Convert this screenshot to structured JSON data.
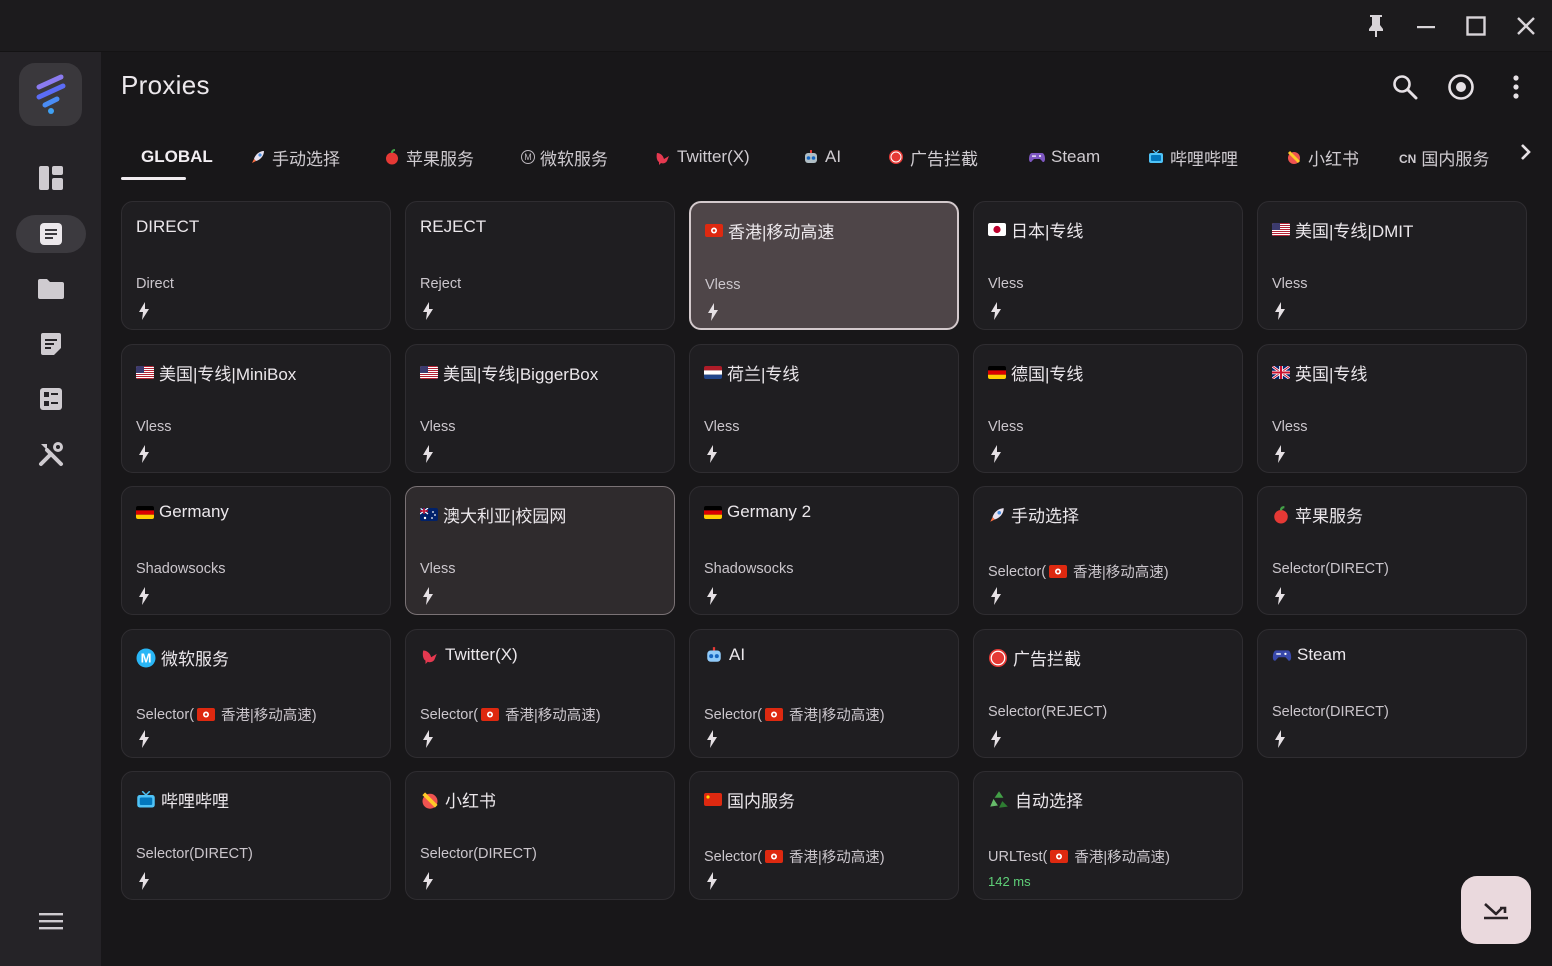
{
  "window_controls": {
    "pin": "pin-icon",
    "minimize": "minimize-icon",
    "maximize": "maximize-icon",
    "close": "close-icon"
  },
  "page": {
    "title": "Proxies"
  },
  "tabs": [
    {
      "label": "GLOBAL",
      "icon": ""
    },
    {
      "label": "手动选择",
      "icon": "rocket-icon"
    },
    {
      "label": "苹果服务",
      "icon": "apple-icon"
    },
    {
      "label": "微软服务",
      "icon": "microsoft-icon"
    },
    {
      "label": "Twitter(X)",
      "icon": "bird-icon"
    },
    {
      "label": "AI",
      "icon": "robot-icon"
    },
    {
      "label": "广告拦截",
      "icon": "stop-icon"
    },
    {
      "label": "Steam",
      "icon": "gamepad-icon"
    },
    {
      "label": "哔哩哔哩",
      "icon": "tv-icon"
    },
    {
      "label": "小红书",
      "icon": "red-icon"
    },
    {
      "label": "国内服务",
      "icon": "cn-icon",
      "prefix": "CN"
    }
  ],
  "proxies": [
    {
      "name": "DIRECT",
      "type": "Direct"
    },
    {
      "name": "REJECT",
      "type": "Reject"
    },
    {
      "name": "香港|移动高速",
      "type": "Vless",
      "flag": "hk",
      "selected": true
    },
    {
      "name": "日本|专线",
      "type": "Vless",
      "flag": "jp"
    },
    {
      "name": "美国|专线|DMIT",
      "type": "Vless",
      "flag": "us"
    },
    {
      "name": "美国|专线|MiniBox",
      "type": "Vless",
      "flag": "us"
    },
    {
      "name": "美国|专线|BiggerBox",
      "type": "Vless",
      "flag": "us"
    },
    {
      "name": "荷兰|专线",
      "type": "Vless",
      "flag": "nl"
    },
    {
      "name": "德国|专线",
      "type": "Vless",
      "flag": "de"
    },
    {
      "name": "英国|专线",
      "type": "Vless",
      "flag": "gb"
    },
    {
      "name": "Germany",
      "type": "Shadowsocks",
      "flag": "de"
    },
    {
      "name": "澳大利亚|校园网",
      "type": "Vless",
      "flag": "au",
      "highlight": true
    },
    {
      "name": "Germany 2",
      "type": "Shadowsocks",
      "flag": "de"
    },
    {
      "name": "手动选择",
      "type": "Selector(",
      "type_flag": "hk",
      "type_rest": "香港|移动高速)",
      "icon": "rocket-icon"
    },
    {
      "name": "苹果服务",
      "type": "Selector(DIRECT)",
      "icon": "apple-icon"
    },
    {
      "name": "微软服务",
      "type": "Selector(",
      "type_flag": "hk",
      "type_rest": "香港|移动高速)",
      "icon": "microsoft-icon"
    },
    {
      "name": "Twitter(X)",
      "type": "Selector(",
      "type_flag": "hk",
      "type_rest": "香港|移动高速)",
      "icon": "bird-icon"
    },
    {
      "name": "AI",
      "type": "Selector(",
      "type_flag": "hk",
      "type_rest": "香港|移动高速)",
      "icon": "robot-icon"
    },
    {
      "name": "广告拦截",
      "type": "Selector(REJECT)",
      "icon": "stop-icon"
    },
    {
      "name": "Steam",
      "type": "Selector(DIRECT)",
      "icon": "gamepad-icon"
    },
    {
      "name": "哔哩哔哩",
      "type": "Selector(DIRECT)",
      "icon": "tv-icon"
    },
    {
      "name": "小红书",
      "type": "Selector(DIRECT)",
      "icon": "red-icon"
    },
    {
      "name": "国内服务",
      "type": "Selector(",
      "type_flag": "hk",
      "type_rest": "香港|移动高速)",
      "flag": "cn"
    },
    {
      "name": "自动选择",
      "type": "URLTest(",
      "type_flag": "hk",
      "type_rest": "香港|移动高速)",
      "icon": "recycle-icon",
      "delay": "142 ms"
    }
  ],
  "colors": {
    "accent": "#ead9dd",
    "delay_good": "#5fcf78",
    "selected_card": "#4e4548"
  }
}
